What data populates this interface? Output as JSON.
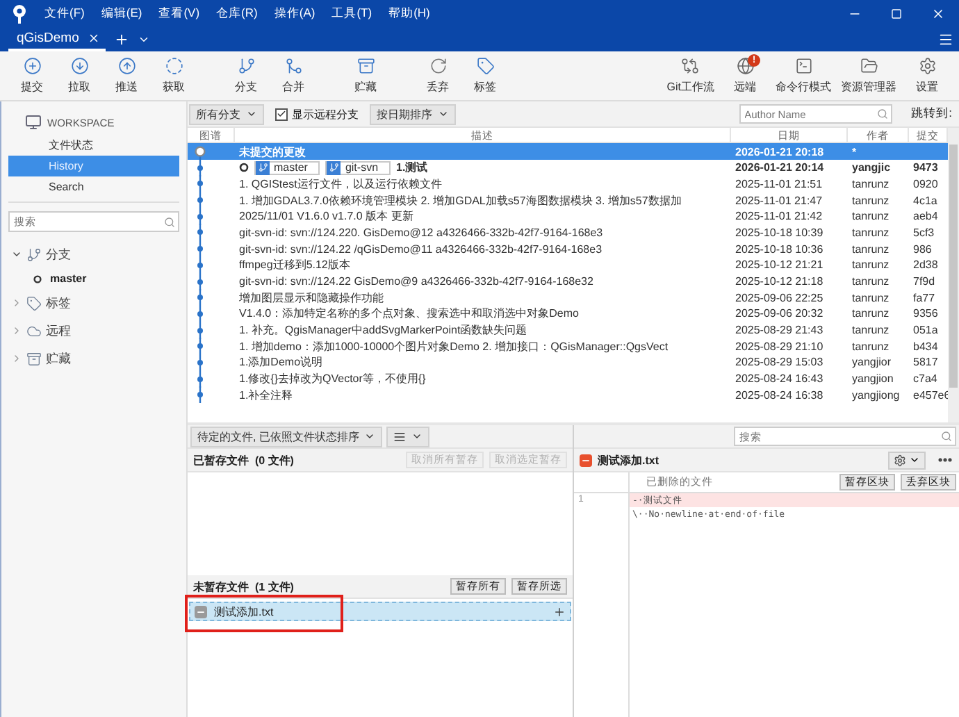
{
  "window": {
    "menus": [
      "文件(F)",
      "编辑(E)",
      "查看(V)",
      "仓库(R)",
      "操作(A)",
      "工具(T)",
      "帮助(H)"
    ]
  },
  "tabs": [
    {
      "label": "qGisDemo",
      "selected": true
    }
  ],
  "toolbar": {
    "groups": [
      {
        "items": [
          {
            "kind": "commit",
            "label": "提交"
          },
          {
            "kind": "pull",
            "label": "拉取"
          },
          {
            "kind": "push",
            "label": "推送"
          },
          {
            "kind": "fetch",
            "label": "获取"
          }
        ]
      },
      {
        "items": [
          {
            "kind": "branch",
            "label": "分支"
          },
          {
            "kind": "merge",
            "label": "合并"
          }
        ]
      },
      {
        "items": [
          {
            "kind": "stash",
            "label": "贮藏"
          }
        ]
      },
      {
        "items": [
          {
            "kind": "discard",
            "label": "丢弃"
          },
          {
            "kind": "tag",
            "label": "标签"
          }
        ]
      }
    ],
    "right_items": [
      {
        "kind": "gitflow",
        "label": "Git工作流"
      },
      {
        "kind": "remote",
        "label": "远端",
        "alert": "!"
      },
      {
        "kind": "terminal",
        "label": "命令行模式"
      },
      {
        "kind": "explorer",
        "label": "资源管理器"
      },
      {
        "kind": "settings",
        "label": "设置"
      }
    ]
  },
  "sidebar": {
    "workspace": "WORKSPACE",
    "views": [
      {
        "label": "文件状态",
        "selected": false
      },
      {
        "label": "History",
        "selected": true
      },
      {
        "label": "Search",
        "selected": false
      }
    ],
    "search": {
      "placeholder": "搜索"
    },
    "sections": [
      {
        "kind": "branch",
        "label": "分支",
        "expanded": true,
        "children": [
          {
            "label": "master",
            "current": true
          }
        ]
      },
      {
        "kind": "tag",
        "label": "标签",
        "expanded": false
      },
      {
        "kind": "remote",
        "label": "远程",
        "expanded": false
      },
      {
        "kind": "stash",
        "label": "贮藏",
        "expanded": false
      }
    ]
  },
  "history": {
    "branch_filter": "所有分支",
    "show_remote": {
      "label": "显示远程分支",
      "checked": true
    },
    "sort": "按日期排序",
    "author_filter": {
      "placeholder": "Author Name"
    },
    "jump_label": "跳转到:",
    "columns": [
      "图谱",
      "描述",
      "日期",
      "作者",
      "提交"
    ],
    "rows": [
      {
        "kind": "uncommitted",
        "description": "未提交的更改",
        "date": "2026-01-21 20:18",
        "author": "*",
        "selected": true,
        "bold": true
      },
      {
        "kind": "commit",
        "head": true,
        "refs": [
          "master",
          "git-svn"
        ],
        "description": "1.测试",
        "date": "2026-01-21 20:14",
        "author": "yangjic",
        "hash": "9473",
        "selected": false,
        "bold": true
      },
      {
        "kind": "commit",
        "description": "1. QGIStest运行文件，以及运行依赖文件",
        "date": "2025-11-01 21:51",
        "author": "tanrunz",
        "hash": "0920",
        "selected": false,
        "bold": false
      },
      {
        "kind": "commit",
        "description": "1. 增加GDAL3.7.0依赖环境管理模块 2. 增加GDAL加载s57海图数据模块 3. 增加s57数据加",
        "date": "2025-11-01 21:47",
        "author": "tanrunz",
        "hash": "4c1a",
        "selected": false,
        "bold": false
      },
      {
        "kind": "commit",
        "description": "2025/11/01 V1.6.0 v1.7.0 版本 更新",
        "date": "2025-11-01 21:42",
        "author": "tanrunz",
        "hash": "aeb4",
        "selected": false,
        "bold": false
      },
      {
        "kind": "commit",
        "description": "git-svn-id: svn://124.220. GisDemo@12 a4326466-332b-42f7-9164-168e3",
        "date": "2025-10-18 10:39",
        "author": "tanrunz",
        "hash": "5cf3",
        "selected": false,
        "bold": false
      },
      {
        "kind": "commit",
        "description": "git-svn-id: svn://124.22 /qGisDemo@11 a4326466-332b-42f7-9164-168e3",
        "date": "2025-10-18 10:36",
        "author": "tanrunz",
        "hash": "986",
        "selected": false,
        "bold": false
      },
      {
        "kind": "commit",
        "description": "ffmpeg迁移到5.12版本",
        "date": "2025-10-12 21:21",
        "author": "tanrunz",
        "hash": "2d38",
        "selected": false,
        "bold": false
      },
      {
        "kind": "commit",
        "description": "git-svn-id: svn://124.22 GisDemo@9 a4326466-332b-42f7-9164-168e32",
        "date": "2025-10-12 21:18",
        "author": "tanrunz",
        "hash": "7f9d",
        "selected": false,
        "bold": false
      },
      {
        "kind": "commit",
        "description": "增加图层显示和隐藏操作功能",
        "date": "2025-09-06 22:25",
        "author": "tanrunz",
        "hash": "fa77",
        "selected": false,
        "bold": false
      },
      {
        "kind": "commit",
        "description": "V1.4.0：添加特定名称的多个点对象、搜索选中和取消选中对象Demo",
        "date": "2025-09-06 20:32",
        "author": "tanrunz",
        "hash": "9356",
        "selected": false,
        "bold": false
      },
      {
        "kind": "commit",
        "description": "1. 补充。QgisManager中addSvgMarkerPoint函数缺失问题",
        "date": "2025-08-29 21:43",
        "author": "tanrunz",
        "hash": "051a",
        "selected": false,
        "bold": false
      },
      {
        "kind": "commit",
        "description": "1. 增加demo：添加1000-10000个图片对象Demo 2. 增加接口：QGisManager::QgsVect",
        "date": "2025-08-29 21:10",
        "author": "tanrunz",
        "hash": "b434",
        "selected": false,
        "bold": false
      },
      {
        "kind": "commit",
        "description": "1.添加Demo说明",
        "date": "2025-08-29 15:03",
        "author": "yangjior",
        "hash": "5817",
        "selected": false,
        "bold": false
      },
      {
        "kind": "commit",
        "description": "1.修改{}去掉改为QVector等，不使用{}",
        "date": "2025-08-24 16:43",
        "author": "yangjion",
        "hash": "c7a4",
        "selected": false,
        "bold": false
      },
      {
        "kind": "commit",
        "description": "1.补全注释",
        "date": "2025-08-24 16:38",
        "author": "yangjiong",
        "hash": "e457e6",
        "selected": false,
        "bold": false
      }
    ]
  },
  "pending": {
    "sort_dropdown": "待定的文件, 已依照文件状态排序",
    "staged": {
      "title": "已暂存文件",
      "count": "(0 文件)",
      "buttons": [
        {
          "label": "取消所有暂存",
          "disabled": true
        },
        {
          "label": "取消选定暂存",
          "disabled": true
        }
      ]
    },
    "unstaged": {
      "title": "未暂存文件",
      "count": "(1 文件)",
      "buttons": [
        {
          "label": "暂存所有",
          "disabled": false
        },
        {
          "label": "暂存所选",
          "disabled": false
        }
      ],
      "files": [
        {
          "name": "测试添加.txt",
          "kind": "removed",
          "selected": true
        }
      ]
    }
  },
  "diff": {
    "search": {
      "placeholder": "搜索"
    },
    "file": {
      "name": "测试添加.txt",
      "kind": "removed"
    },
    "hunk": {
      "title": "已删除的文件",
      "buttons": [
        "暂存区块",
        "丢弃区块"
      ],
      "line_numbers": [
        "1"
      ],
      "lines": [
        {
          "kind": "removed",
          "text": "-·测试文件"
        },
        {
          "kind": "context",
          "text": "\\··No·newline·at·end·of·file"
        }
      ]
    }
  }
}
